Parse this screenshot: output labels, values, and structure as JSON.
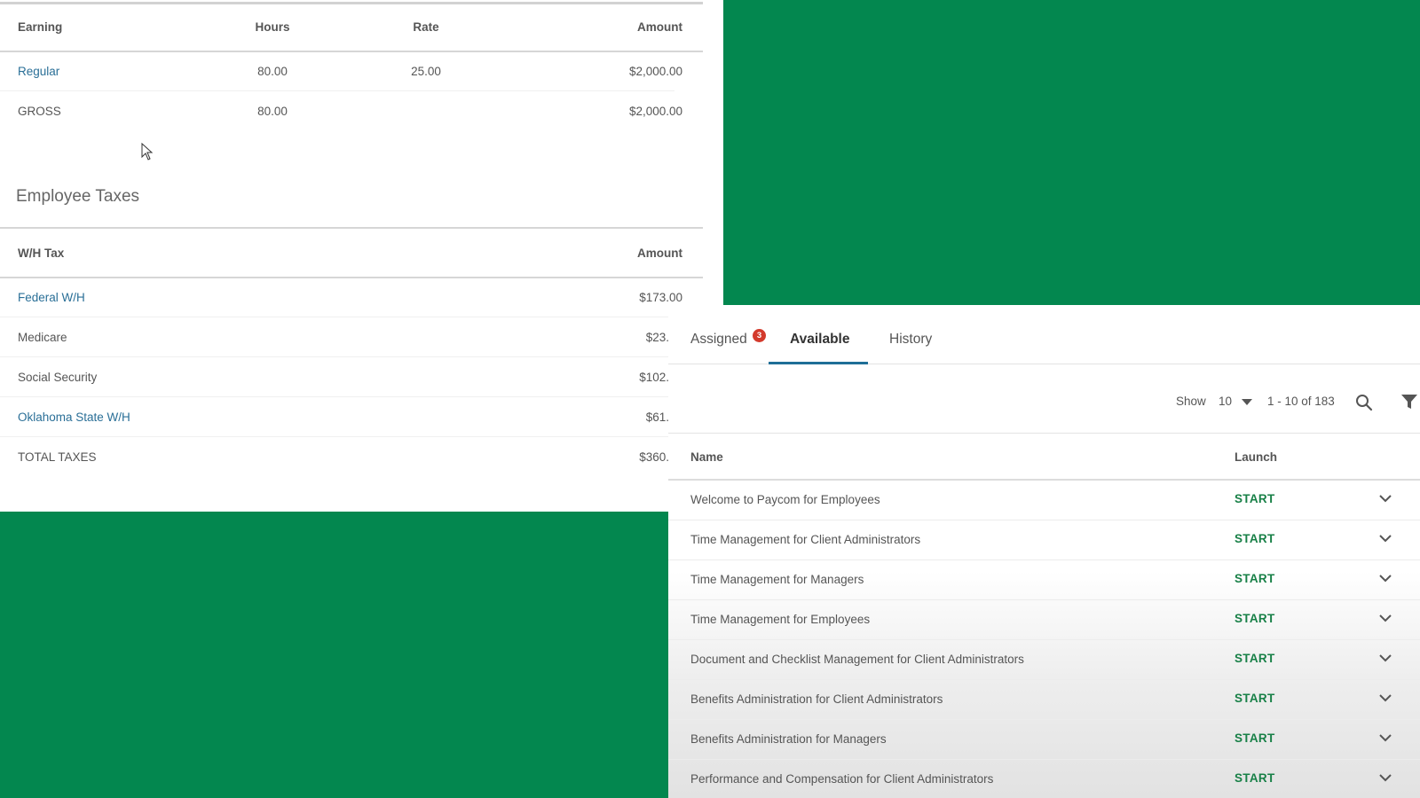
{
  "paystub": {
    "earnings": {
      "headers": {
        "earning": "Earning",
        "hours": "Hours",
        "rate": "Rate",
        "amount": "Amount"
      },
      "rows": [
        {
          "earning": "Regular",
          "hours": "80.00",
          "rate": "25.00",
          "amount": "$2,000.00"
        },
        {
          "earning": "GROSS",
          "hours": "80.00",
          "rate": "",
          "amount": "$2,000.00"
        }
      ]
    },
    "taxes": {
      "section_title": "Employee Taxes",
      "headers": {
        "tax": "W/H Tax",
        "amount": "Amount"
      },
      "rows": [
        {
          "tax": "Federal W/H",
          "amount": "$173.00"
        },
        {
          "tax": "Medicare",
          "amount": "$23."
        },
        {
          "tax": "Social Security",
          "amount": "$102."
        },
        {
          "tax": "Oklahoma State W/H",
          "amount": "$61."
        },
        {
          "tax": "TOTAL TAXES",
          "amount": "$360."
        }
      ]
    }
  },
  "training": {
    "tabs": [
      {
        "label": "Assigned",
        "badge": "3",
        "active": false
      },
      {
        "label": "Available",
        "active": true
      },
      {
        "label": "History",
        "active": false
      }
    ],
    "toolbar": {
      "show_label": "Show",
      "page_size": "10",
      "range": "1 - 10 of 183",
      "search_icon": "search-icon",
      "filter_icon": "filter-icon"
    },
    "columns": {
      "name": "Name",
      "launch": "Launch"
    },
    "courses": [
      {
        "name": "Welcome to Paycom for Employees",
        "launch": "START"
      },
      {
        "name": "Time Management for Client Administrators",
        "launch": "START"
      },
      {
        "name": "Time Management for Managers",
        "launch": "START"
      },
      {
        "name": "Time Management for Employees",
        "launch": "START"
      },
      {
        "name": "Document and Checklist Management for Client Administrators",
        "launch": "START"
      },
      {
        "name": "Benefits Administration for Client Administrators",
        "launch": "START"
      },
      {
        "name": "Benefits Administration for Managers",
        "launch": "START"
      },
      {
        "name": "Performance and Compensation for Client Administrators",
        "launch": "START"
      }
    ]
  },
  "colors": {
    "background": "#03874f",
    "link": "#2a6f97",
    "start": "#188047",
    "badge": "#d33a2c",
    "tab_underline": "#1f6e97"
  }
}
